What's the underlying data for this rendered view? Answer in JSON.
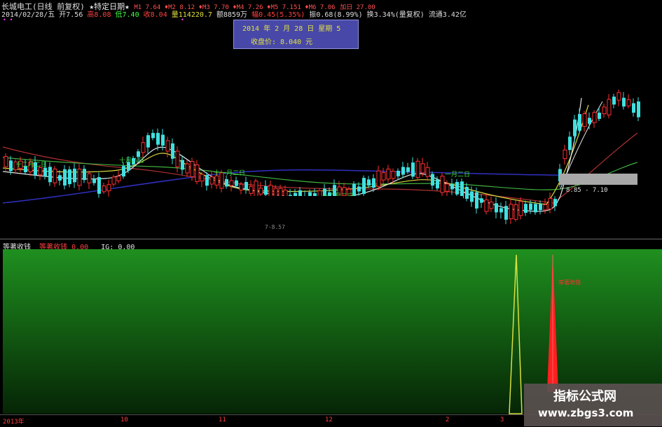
{
  "header": {
    "title": "长城电工(日线 前复权)",
    "marker": "★特定日期★",
    "ma_line": "M1  7.64 ♦M2  8.12 ♦M3  7.70 ♦M4  7.26 ♦M5  7.151 ♦M6  7.06",
    "ma_tail": "加日  27.00",
    "info_date": "2014/02/28/五",
    "info_open": "开7.56",
    "info_high": "高8.08",
    "info_low": "低7.40",
    "info_close": "收8.04",
    "info_vol": "量114220.7",
    "info_amt": "额8859万",
    "info_chg": "幅0.45(5.35%)",
    "info_amp": "振0.68(8.99%)",
    "info_turn": "换3.34%(量复权)",
    "info_float": "流通3.42亿"
  },
  "datebox": {
    "line1": "2014  年  2  月  28  日  星期 5",
    "line2": "收盘价:    8.040   元"
  },
  "chart": {
    "annotations": [
      "十二月二日",
      "十月八日",
      "十一月二日",
      "一月二日",
      "十二月二日"
    ],
    "price_labels": [
      "8.85 - 7.10",
      "7-8.57"
    ]
  },
  "indicator": {
    "name": "等著收钱",
    "name2": "等著收钱",
    "val1": "0.00",
    "ig": "IG: 0.00",
    "signal_label": "等著收钱"
  },
  "axis": {
    "labels": [
      "2013年",
      "10",
      "11",
      "12",
      "2",
      "3"
    ]
  },
  "watermark": {
    "line1": "指标公式网",
    "line2": "www.zbgs3.com"
  },
  "colors": {
    "bg": "#000000",
    "up": "#ff3030",
    "down": "#40e0e0",
    "ma_white": "#e8e8e8",
    "ma_yellow": "#d8d840",
    "ma_green": "#40c040",
    "ma_blue": "#3030c0",
    "ma_red": "#c03030"
  }
}
